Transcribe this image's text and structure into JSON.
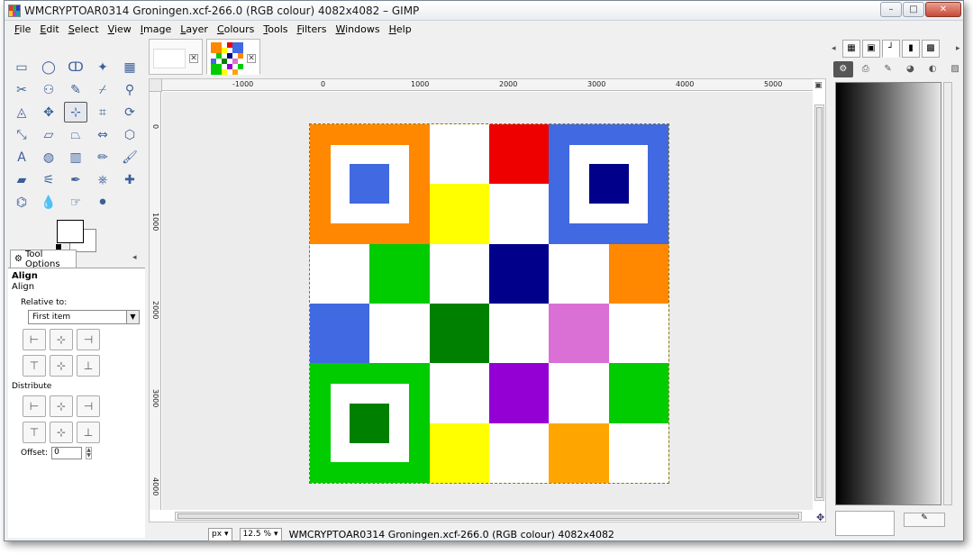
{
  "window": {
    "title": "WMCRYPTOAR0314 Groningen.xcf-266.0 (RGB colour) 4082x4082 – GIMP",
    "minimize_glyph": "–",
    "maximize_glyph": "□",
    "close_glyph": "✕"
  },
  "menu": [
    {
      "first": "F",
      "rest": "ile"
    },
    {
      "first": "E",
      "rest": "dit"
    },
    {
      "first": "S",
      "rest": "elect"
    },
    {
      "first": "V",
      "rest": "iew"
    },
    {
      "first": "I",
      "rest": "mage"
    },
    {
      "first": "L",
      "rest": "ayer"
    },
    {
      "first": "C",
      "rest": "olours"
    },
    {
      "first": "T",
      "rest": "ools"
    },
    {
      "first": "F",
      "rest": "ilters"
    },
    {
      "first": "W",
      "rest": "indows"
    },
    {
      "first": "H",
      "rest": "elp"
    }
  ],
  "toolbox": {
    "tools": [
      {
        "name": "rect-select-icon",
        "glyph": "▭"
      },
      {
        "name": "ellipse-select-icon",
        "glyph": "◯"
      },
      {
        "name": "free-select-icon",
        "glyph": "ↀ"
      },
      {
        "name": "fuzzy-select-icon",
        "glyph": "✦"
      },
      {
        "name": "color-select-icon",
        "glyph": "▦"
      },
      {
        "name": "scissors-icon",
        "glyph": "✂"
      },
      {
        "name": "foreground-select-icon",
        "glyph": "⚇"
      },
      {
        "name": "paths-icon",
        "glyph": "✎"
      },
      {
        "name": "color-picker-icon",
        "glyph": "⌿"
      },
      {
        "name": "zoom-icon",
        "glyph": "⚲"
      },
      {
        "name": "measure-icon",
        "glyph": "◬"
      },
      {
        "name": "move-icon",
        "glyph": "✥"
      },
      {
        "name": "align-icon",
        "glyph": "⊹",
        "active": true
      },
      {
        "name": "crop-icon",
        "glyph": "⌗"
      },
      {
        "name": "rotate-icon",
        "glyph": "⟳"
      },
      {
        "name": "scale-icon",
        "glyph": "⤡"
      },
      {
        "name": "shear-icon",
        "glyph": "▱"
      },
      {
        "name": "perspective-icon",
        "glyph": "⏢"
      },
      {
        "name": "flip-icon",
        "glyph": "⇔"
      },
      {
        "name": "cage-icon",
        "glyph": "⬡"
      },
      {
        "name": "text-icon",
        "glyph": "A"
      },
      {
        "name": "bucket-fill-icon",
        "glyph": "◍"
      },
      {
        "name": "blend-icon",
        "glyph": "▥"
      },
      {
        "name": "pencil-icon",
        "glyph": "✏"
      },
      {
        "name": "paintbrush-icon",
        "glyph": "🖌"
      },
      {
        "name": "eraser-icon",
        "glyph": "▰"
      },
      {
        "name": "airbrush-icon",
        "glyph": "⚟"
      },
      {
        "name": "ink-icon",
        "glyph": "✒"
      },
      {
        "name": "clone-icon",
        "glyph": "⎈"
      },
      {
        "name": "heal-icon",
        "glyph": "✚"
      },
      {
        "name": "perspective-clone-icon",
        "glyph": "⌬"
      },
      {
        "name": "blur-icon",
        "glyph": "💧"
      },
      {
        "name": "smudge-icon",
        "glyph": "☞"
      },
      {
        "name": "dodge-burn-icon",
        "glyph": "⚫"
      }
    ]
  },
  "tool_options": {
    "tab_label": "Tool Options",
    "title": "Align",
    "subtitle": "Align",
    "relative_label": "Relative to:",
    "relative_value": "First item",
    "distribute_label": "Distribute",
    "offset_label": "Offset:",
    "offset_value": "0"
  },
  "rulers": {
    "h_labels": [
      "-1000",
      "0",
      "1000",
      "2000",
      "3000",
      "4000",
      "5000"
    ],
    "v_labels": [
      "0",
      "1000",
      "2000",
      "3000",
      "4000"
    ]
  },
  "status": {
    "unit": "px",
    "zoom": "12.5 %",
    "text": "WMCRYPTOAR0314 Groningen.xcf-266.0 (RGB colour) 4082x4082"
  },
  "canvas": {
    "cells": [
      {
        "bg": "#ff8800",
        "inner": "#ffffff",
        "core": "#4169e1",
        "span": 2,
        "rowspan": 2
      },
      {
        "bg": "#ffffff"
      },
      {
        "bg": "#ee0000"
      },
      {
        "bg": "#4169e1",
        "inner": "#ffffff",
        "core": "#00008b",
        "span": 2,
        "rowspan": 2
      },
      {
        "bg": "#ffff00"
      },
      {
        "bg": "#ffffff"
      },
      {
        "bg": "#ffffff"
      },
      {
        "bg": "#00cc00"
      },
      {
        "bg": "#ffffff"
      },
      {
        "bg": "#00008b"
      },
      {
        "bg": "#ffffff"
      },
      {
        "bg": "#ff8800"
      },
      {
        "bg": "#4169e1"
      },
      {
        "bg": "#ffffff"
      },
      {
        "bg": "#008000"
      },
      {
        "bg": "#ffffff"
      },
      {
        "bg": "#da70d6"
      },
      {
        "bg": "#ffffff"
      },
      {
        "bg": "#00cc00",
        "inner": "#ffffff",
        "core": "#008000",
        "span": 2,
        "rowspan": 2
      },
      {
        "bg": "#ffffff"
      },
      {
        "bg": "#9400d3"
      },
      {
        "bg": "#ffffff"
      },
      {
        "bg": "#00cc00"
      },
      {
        "bg": "#ffff00"
      },
      {
        "bg": "#ffffff"
      },
      {
        "bg": "#ffa500"
      },
      {
        "bg": "#ffffff"
      }
    ]
  },
  "dock": {
    "tabs": [
      "▦",
      "▣",
      "┘",
      "▮",
      "▩"
    ]
  }
}
